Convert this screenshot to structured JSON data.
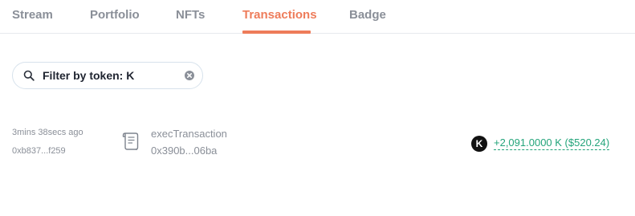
{
  "tabs": [
    {
      "label": "Stream",
      "active": false
    },
    {
      "label": "Portfolio",
      "active": false
    },
    {
      "label": "NFTs",
      "active": false
    },
    {
      "label": "Transactions",
      "active": true
    },
    {
      "label": "Badge",
      "active": false
    }
  ],
  "filter": {
    "value": "Filter by token: K",
    "icons": {
      "search": "search-icon",
      "clear": "clear-icon"
    }
  },
  "transactions": [
    {
      "time": "3mins 38secs ago",
      "from": "0xb837...f259",
      "icon": "scroll-icon",
      "method": "execTransaction",
      "hash": "0x390b...06ba",
      "token_symbol": "K",
      "amount": "+2,091.0000 K ($520.24)"
    }
  ],
  "colors": {
    "accent": "#ee7c5a",
    "muted_text": "#8a8f98",
    "positive": "#23a47a",
    "token_bg": "#111111"
  }
}
